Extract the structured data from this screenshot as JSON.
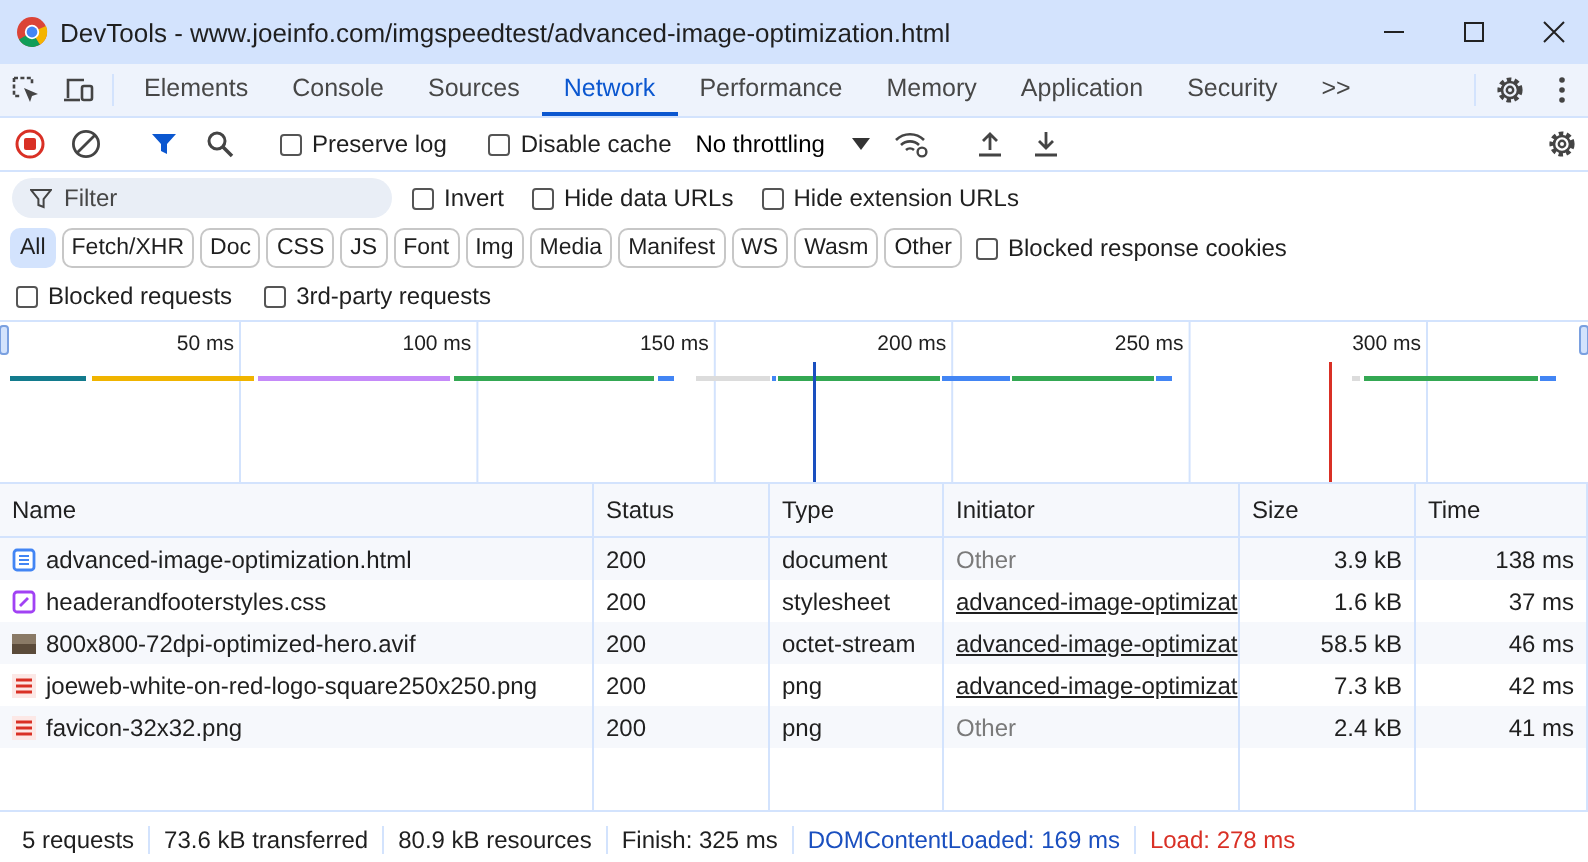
{
  "window": {
    "title": "DevTools - www.joeinfo.com/imgspeedtest/advanced-image-optimization.html"
  },
  "tabs": [
    {
      "label": "Elements",
      "selected": false
    },
    {
      "label": "Console",
      "selected": false
    },
    {
      "label": "Sources",
      "selected": false
    },
    {
      "label": "Network",
      "selected": true
    },
    {
      "label": "Performance",
      "selected": false
    },
    {
      "label": "Memory",
      "selected": false
    },
    {
      "label": "Application",
      "selected": false
    },
    {
      "label": "Security",
      "selected": false
    }
  ],
  "more_tabs": ">>",
  "toolbar": {
    "recording": true,
    "preserve_log": {
      "label": "Preserve log",
      "checked": false
    },
    "disable_cache": {
      "label": "Disable cache",
      "checked": false
    },
    "throttling": "No throttling"
  },
  "filter": {
    "placeholder": "Filter",
    "options": [
      {
        "label": "Invert",
        "checked": false
      },
      {
        "label": "Hide data URLs",
        "checked": false
      },
      {
        "label": "Hide extension URLs",
        "checked": false
      }
    ]
  },
  "type_filters": [
    {
      "label": "All",
      "selected": true
    },
    {
      "label": "Fetch/XHR",
      "selected": false
    },
    {
      "label": "Doc",
      "selected": false
    },
    {
      "label": "CSS",
      "selected": false
    },
    {
      "label": "JS",
      "selected": false
    },
    {
      "label": "Font",
      "selected": false
    },
    {
      "label": "Img",
      "selected": false
    },
    {
      "label": "Media",
      "selected": false
    },
    {
      "label": "Manifest",
      "selected": false
    },
    {
      "label": "WS",
      "selected": false
    },
    {
      "label": "Wasm",
      "selected": false
    },
    {
      "label": "Other",
      "selected": false
    }
  ],
  "blocked_cookies": {
    "label": "Blocked response cookies",
    "checked": false
  },
  "extra_options": [
    {
      "label": "Blocked requests",
      "checked": false
    },
    {
      "label": "3rd-party requests",
      "checked": false
    }
  ],
  "overview": {
    "ticks": [
      "50 ms",
      "100 ms",
      "150 ms",
      "200 ms",
      "250 ms",
      "300 ms"
    ]
  },
  "table": {
    "columns": [
      "Name",
      "Status",
      "Type",
      "Initiator",
      "Size",
      "Time"
    ],
    "rows": [
      {
        "kind": "document",
        "name": "advanced-image-optimization.html",
        "status": "200",
        "type": "document",
        "initiator": "Other",
        "initiator_link": false,
        "size": "3.9 kB",
        "time": "138 ms"
      },
      {
        "kind": "stylesheet",
        "name": "headerandfooterstyles.css",
        "status": "200",
        "type": "stylesheet",
        "initiator": "advanced-image-optimizat",
        "initiator_link": true,
        "size": "1.6 kB",
        "time": "37 ms"
      },
      {
        "kind": "photo",
        "name": "800x800-72dpi-optimized-hero.avif",
        "status": "200",
        "type": "octet-stream",
        "initiator": "advanced-image-optimizat",
        "initiator_link": true,
        "size": "58.5 kB",
        "time": "46 ms"
      },
      {
        "kind": "logo",
        "name": "joeweb-white-on-red-logo-square250x250.png",
        "status": "200",
        "type": "png",
        "initiator": "advanced-image-optimizat",
        "initiator_link": true,
        "size": "7.3 kB",
        "time": "42 ms"
      },
      {
        "kind": "logo",
        "name": "favicon-32x32.png",
        "status": "200",
        "type": "png",
        "initiator": "Other",
        "initiator_link": false,
        "size": "2.4 kB",
        "time": "41 ms"
      }
    ]
  },
  "status_bar": [
    {
      "text": "5 requests",
      "kind": "plain"
    },
    {
      "text": "73.6 kB transferred",
      "kind": "plain"
    },
    {
      "text": "80.9 kB resources",
      "kind": "plain"
    },
    {
      "text": "Finish: 325 ms",
      "kind": "plain"
    },
    {
      "text": "DOMContentLoaded: 169 ms",
      "kind": "dom"
    },
    {
      "text": "Load: 278 ms",
      "kind": "load"
    }
  ]
}
